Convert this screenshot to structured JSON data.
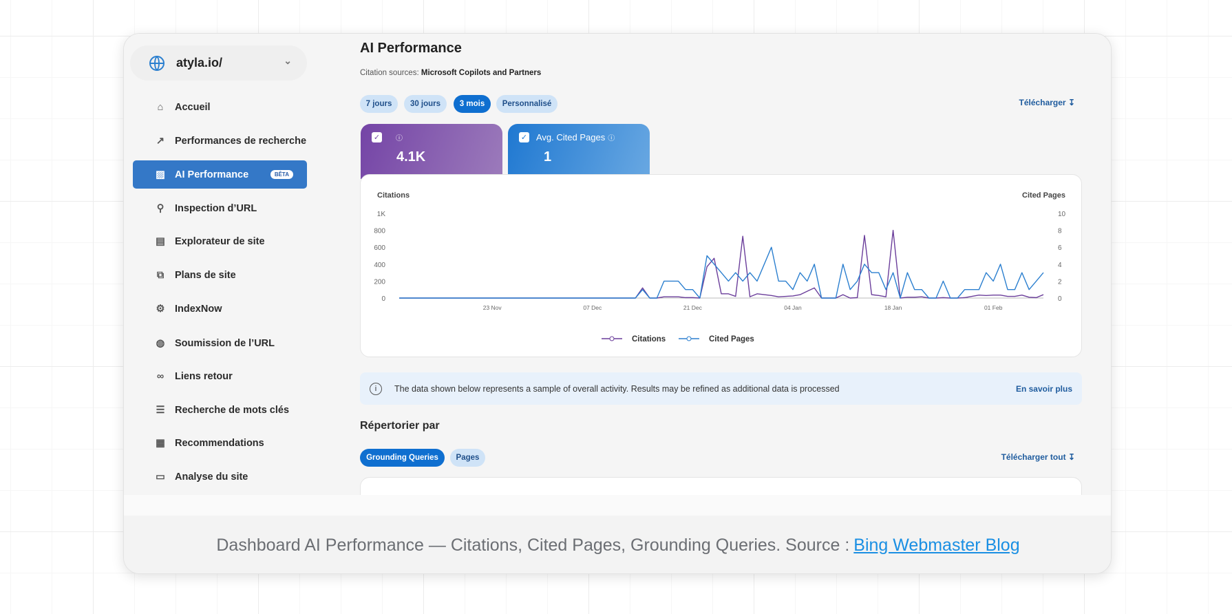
{
  "site": {
    "name": "atyla.io/"
  },
  "nav": [
    {
      "label": "Accueil",
      "icon": "home-icon"
    },
    {
      "label": "Performances de recherche",
      "icon": "trend-icon"
    },
    {
      "label": "AI Performance",
      "icon": "chart-icon",
      "badge": "BÊTA",
      "active": true
    },
    {
      "label": "Inspection d’URL",
      "icon": "search-icon"
    },
    {
      "label": "Explorateur de site",
      "icon": "document-icon"
    },
    {
      "label": "Plans de site",
      "icon": "sitemap-icon"
    },
    {
      "label": "IndexNow",
      "icon": "gear-icon"
    },
    {
      "label": "Soumission de l’URL",
      "icon": "globe-icon"
    },
    {
      "label": "Liens retour",
      "icon": "link-icon"
    },
    {
      "label": "Recherche de mots clés",
      "icon": "list-icon"
    },
    {
      "label": "Recommendations",
      "icon": "report-icon"
    },
    {
      "label": "Analyse du site",
      "icon": "browser-icon"
    }
  ],
  "main": {
    "title": "AI Performance",
    "sources_label": "Citation sources:",
    "sources_value": "Microsoft Copilots and Partners",
    "ranges": [
      "7 jours",
      "30 jours",
      "3 mois",
      "Personnalisé"
    ],
    "active_range": "3 mois",
    "download": "Télécharger",
    "metrics": [
      {
        "label": "",
        "value": "4.1K",
        "checked": true,
        "color": "#7a4aa8"
      },
      {
        "label": "Avg. Cited Pages",
        "value": "1",
        "checked": true,
        "color": "#2a7fd4"
      }
    ],
    "info": {
      "text": "The data shown below represents a sample of overall activity. Results may be refined as additional data is processed",
      "link": "En savoir plus"
    },
    "list_title": "Répertorier par",
    "list_tabs": [
      "Grounding Queries",
      "Pages"
    ],
    "active_list_tab": "Grounding Queries",
    "download_all": "Télécharger tout"
  },
  "chart_data": {
    "type": "line",
    "ylabel": "Citations",
    "y2label": "Cited Pages",
    "ylim": [
      0,
      1000
    ],
    "y2lim": [
      0,
      10
    ],
    "yticks": [
      "0",
      "200",
      "400",
      "600",
      "800",
      "1K"
    ],
    "y2ticks": [
      "0",
      "2",
      "4",
      "6",
      "8",
      "10"
    ],
    "xticks": [
      "23 Nov",
      "07 Dec",
      "21 Dec",
      "04 Jan",
      "18 Jan",
      "01 Feb"
    ],
    "grid": false,
    "legend": "bottom",
    "x": [
      "10 Nov",
      "11 Nov",
      "12 Nov",
      "13 Nov",
      "14 Nov",
      "15 Nov",
      "16 Nov",
      "17 Nov",
      "18 Nov",
      "19 Nov",
      "20 Nov",
      "21 Nov",
      "22 Nov",
      "23 Nov",
      "24 Nov",
      "25 Nov",
      "26 Nov",
      "27 Nov",
      "28 Nov",
      "29 Nov",
      "30 Nov",
      "01 Dec",
      "02 Dec",
      "03 Dec",
      "04 Dec",
      "05 Dec",
      "06 Dec",
      "07 Dec",
      "08 Dec",
      "09 Dec",
      "10 Dec",
      "11 Dec",
      "12 Dec",
      "13 Dec",
      "14 Dec",
      "15 Dec",
      "16 Dec",
      "17 Dec",
      "18 Dec",
      "19 Dec",
      "20 Dec",
      "21 Dec",
      "22 Dec",
      "23 Dec",
      "24 Dec",
      "25 Dec",
      "26 Dec",
      "27 Dec",
      "28 Dec",
      "29 Dec",
      "30 Dec",
      "31 Dec",
      "01 Jan",
      "02 Jan",
      "03 Jan",
      "04 Jan",
      "05 Jan",
      "06 Jan",
      "07 Jan",
      "08 Jan",
      "09 Jan",
      "10 Jan",
      "11 Jan",
      "12 Jan",
      "13 Jan",
      "14 Jan",
      "15 Jan",
      "16 Jan",
      "17 Jan",
      "18 Jan",
      "19 Jan",
      "20 Jan",
      "21 Jan",
      "22 Jan",
      "23 Jan",
      "24 Jan",
      "25 Jan",
      "26 Jan",
      "27 Jan",
      "28 Jan",
      "29 Jan",
      "30 Jan",
      "31 Jan",
      "01 Feb",
      "02 Feb",
      "03 Feb",
      "04 Feb",
      "05 Feb",
      "06 Feb",
      "07 Feb",
      "08 Feb"
    ],
    "series": [
      {
        "name": "Citations",
        "axis": "left",
        "color": "#6a3d9a",
        "values": [
          0,
          0,
          0,
          0,
          0,
          0,
          0,
          0,
          0,
          0,
          0,
          0,
          0,
          0,
          0,
          0,
          0,
          0,
          0,
          0,
          0,
          0,
          0,
          0,
          0,
          0,
          0,
          0,
          0,
          0,
          0,
          0,
          0,
          0,
          120,
          0,
          0,
          15,
          15,
          15,
          5,
          5,
          0,
          370,
          470,
          50,
          50,
          20,
          730,
          15,
          50,
          40,
          30,
          15,
          20,
          25,
          40,
          80,
          120,
          0,
          0,
          0,
          40,
          0,
          5,
          740,
          40,
          30,
          15,
          800,
          0,
          10,
          10,
          15,
          0,
          0,
          5,
          0,
          0,
          5,
          20,
          35,
          30,
          35,
          35,
          20,
          20,
          35,
          10,
          5,
          40
        ]
      },
      {
        "name": "Cited Pages",
        "axis": "right",
        "color": "#2b7fcf",
        "values": [
          0,
          0,
          0,
          0,
          0,
          0,
          0,
          0,
          0,
          0,
          0,
          0,
          0,
          0,
          0,
          0,
          0,
          0,
          0,
          0,
          0,
          0,
          0,
          0,
          0,
          0,
          0,
          0,
          0,
          0,
          0,
          0,
          0,
          0,
          1,
          0,
          0,
          2,
          2,
          2,
          1,
          1,
          0,
          5,
          4,
          3,
          2,
          3,
          2,
          3,
          2,
          4,
          6,
          2,
          2,
          1,
          3,
          2,
          4,
          0,
          0,
          0,
          4,
          1,
          2,
          4,
          3,
          3,
          1,
          3,
          0,
          3,
          1,
          1,
          0,
          0,
          2,
          0,
          0,
          1,
          1,
          1,
          3,
          2,
          4,
          1,
          1,
          3,
          1,
          2,
          3
        ]
      }
    ]
  },
  "caption": {
    "text": "Dashboard AI Performance — Citations, Cited Pages, Grounding Queries. Source :",
    "link": "Bing Webmaster Blog"
  }
}
